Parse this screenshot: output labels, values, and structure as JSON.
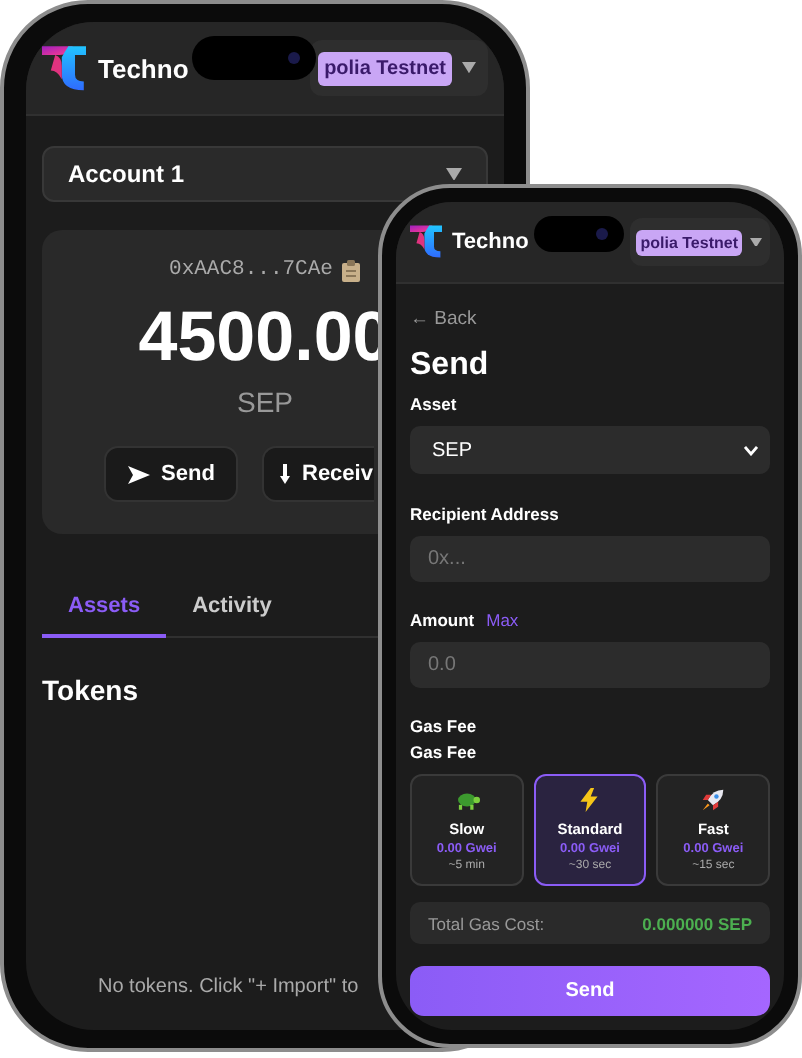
{
  "wallet_phone": {
    "header": {
      "app_name": "Techno",
      "network": "polia Testnet"
    },
    "account": "Account 1",
    "address": "0xAAC8...7CAe",
    "balance": "4500.00",
    "unit": "SEP",
    "actions": [
      {
        "label": "Send",
        "kind": "send"
      },
      {
        "label": "Receiv",
        "kind": "receive"
      }
    ],
    "tabs": [
      {
        "label": "Assets",
        "selected": true
      },
      {
        "label": "Activity",
        "selected": false
      }
    ],
    "section_title": "Tokens",
    "empty_message": "No tokens. Click \"+ Import\" to"
  },
  "send_phone": {
    "header": {
      "app_name": "Techno",
      "network": "polia Testnet"
    },
    "back": "← Back",
    "title": "Send",
    "fields": [
      {
        "label": "Asset",
        "kind": "select",
        "value": "SEP"
      },
      {
        "label": "Recipient Address",
        "kind": "input",
        "placeholder": "0x..."
      },
      {
        "label": "Amount",
        "kind": "input",
        "placeholder": "0.0",
        "action": "Max"
      }
    ],
    "gas_heading": "Gas Fee",
    "gas_subheading": "Gas Fee",
    "gas_options": [
      {
        "name": "Slow",
        "kind": "slow",
        "price": "0.00 Gwei",
        "time": "~5 min",
        "selected": false
      },
      {
        "name": "Standard",
        "kind": "standard",
        "price": "0.00 Gwei",
        "time": "~30 sec",
        "selected": true
      },
      {
        "name": "Fast",
        "kind": "fast",
        "price": "0.00 Gwei",
        "time": "~15 sec",
        "selected": false
      }
    ],
    "total": {
      "label": "Total Gas Cost:",
      "value": "0.000000 SEP"
    },
    "submit": "Send"
  }
}
